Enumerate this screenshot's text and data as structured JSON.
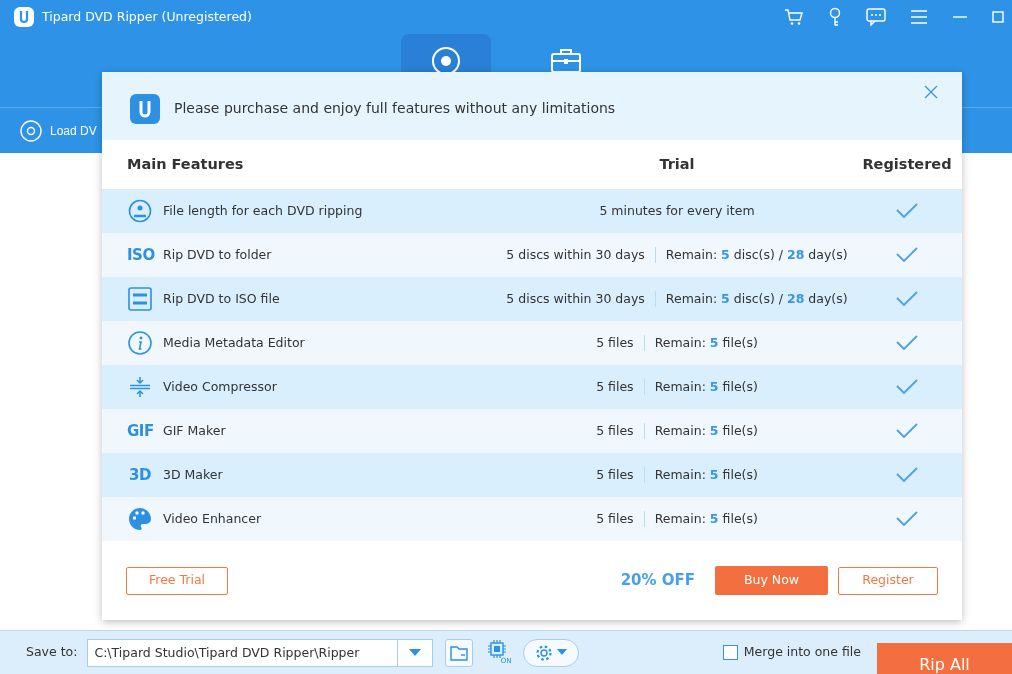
{
  "window": {
    "title": "Tipard DVD Ripper (Unregistered)"
  },
  "top_tabs": [
    {
      "kind": "ripper",
      "selected": true
    },
    {
      "kind": "toolbox",
      "selected": false
    }
  ],
  "load_dvd": {
    "label": "Load DV"
  },
  "dialog": {
    "message": "Please purchase and enjoy full features without any limitations",
    "columns": [
      "Main Features",
      "Trial",
      "Registered"
    ],
    "features": [
      {
        "kind": "disc",
        "name": "File length for each DVD ripping",
        "trial": "5 minutes for every item",
        "registered": true
      },
      {
        "kind": "text",
        "icon_text": "ISO",
        "name": "Rip DVD to folder",
        "trial": "5 discs within 30 days",
        "remain": "Remain: **5** disc(s) / **28** day(s)",
        "registered": true
      },
      {
        "kind": "dvd-iso",
        "name": "Rip DVD to ISO file",
        "trial": "5 discs within 30 days",
        "remain": "Remain: **5** disc(s) / **28** day(s)",
        "registered": true
      },
      {
        "kind": "info",
        "name": "Media Metadata Editor",
        "trial": "5 files",
        "remain": "Remain: **5** file(s)",
        "registered": true
      },
      {
        "kind": "compress",
        "name": "Video Compressor",
        "trial": "5 files",
        "remain": "Remain: **5** file(s)",
        "registered": true
      },
      {
        "kind": "text",
        "icon_text": "GIF",
        "name": "GIF Maker",
        "trial": "5 files",
        "remain": "Remain: **5** file(s)",
        "registered": true
      },
      {
        "kind": "text",
        "icon_text": "3D",
        "name": "3D Maker",
        "trial": "5 files",
        "remain": "Remain: **5** file(s)",
        "registered": true
      },
      {
        "kind": "palette",
        "name": "Video Enhancer",
        "trial": "5 files",
        "remain": "Remain: **5** file(s)",
        "registered": true
      }
    ],
    "free_trial": "Free Trial",
    "discount": "20% OFF",
    "buy_now": "Buy Now",
    "register": "Register"
  },
  "bottom_bar": {
    "save_to_label": "Save to:",
    "path": "C:\\Tipard Studio\\Tipard DVD Ripper\\Ripper",
    "acceleration_badge": "ON",
    "merge": {
      "label": "Merge into one file",
      "checked": false
    },
    "rip_all": "Rip All"
  }
}
